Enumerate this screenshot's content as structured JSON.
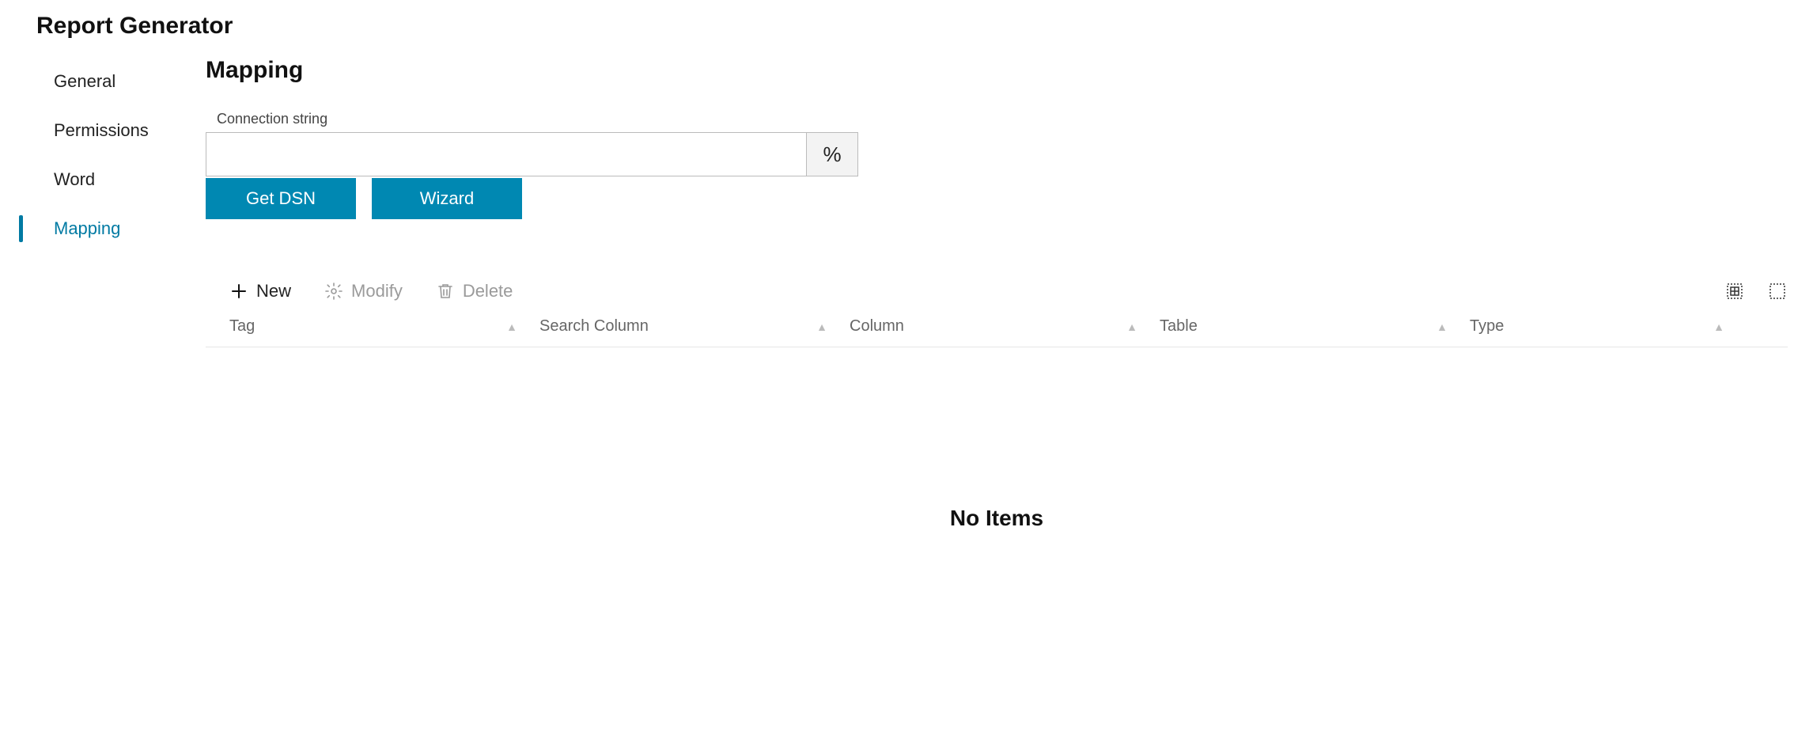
{
  "title": "Report Generator",
  "sidebar": {
    "items": [
      {
        "label": "General",
        "active": false
      },
      {
        "label": "Permissions",
        "active": false
      },
      {
        "label": "Word",
        "active": false
      },
      {
        "label": "Mapping",
        "active": true
      }
    ]
  },
  "main": {
    "heading": "Mapping",
    "connection_label": "Connection string",
    "connection_value": "",
    "percent_button": "%",
    "buttons": {
      "get_dsn": "Get DSN",
      "wizard": "Wizard"
    }
  },
  "toolbar": {
    "new": "New",
    "modify": "Modify",
    "delete": "Delete"
  },
  "table": {
    "columns": {
      "tag": "Tag",
      "search": "Search Column",
      "column": "Column",
      "table": "Table",
      "type": "Type"
    },
    "empty": "No Items"
  }
}
